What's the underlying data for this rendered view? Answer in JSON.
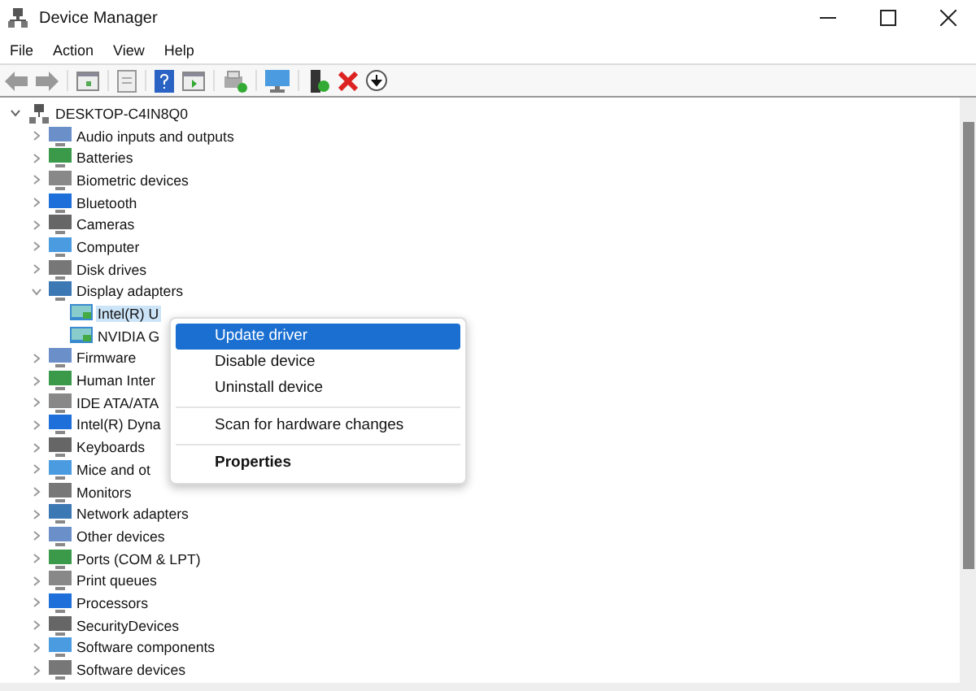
{
  "window": {
    "title": "Device Manager"
  },
  "menu_bar": [
    "File",
    "Action",
    "View",
    "Help"
  ],
  "tree": {
    "label": "DESKTOP-C4IN8Q0",
    "expanded": true,
    "selected": false,
    "children": [
      {
        "label": "Audio inputs and outputs",
        "expanded": false,
        "selected": false
      },
      {
        "label": "Batteries",
        "expanded": false,
        "selected": false
      },
      {
        "label": "Biometric devices",
        "expanded": false,
        "selected": false
      },
      {
        "label": "Bluetooth",
        "expanded": false,
        "selected": false
      },
      {
        "label": "Cameras",
        "expanded": false,
        "selected": false
      },
      {
        "label": "Computer",
        "expanded": false,
        "selected": false
      },
      {
        "label": "Disk drives",
        "expanded": false,
        "selected": false
      },
      {
        "label": "Display adapters",
        "expanded": true,
        "selected": false,
        "children": [
          {
            "label": "Intel(R) U",
            "selected": true
          },
          {
            "label": "NVIDIA G",
            "selected": false
          }
        ]
      },
      {
        "label": "Firmware",
        "expanded": false,
        "selected": false
      },
      {
        "label": "Human Inter",
        "expanded": false,
        "selected": false
      },
      {
        "label": "IDE ATA/ATA",
        "expanded": false,
        "selected": false
      },
      {
        "label": "Intel(R) Dyna",
        "expanded": false,
        "selected": false
      },
      {
        "label": "Keyboards",
        "expanded": false,
        "selected": false
      },
      {
        "label": "Mice and ot",
        "expanded": false,
        "selected": false
      },
      {
        "label": "Monitors",
        "expanded": false,
        "selected": false
      },
      {
        "label": "Network adapters",
        "expanded": false,
        "selected": false
      },
      {
        "label": "Other devices",
        "expanded": false,
        "selected": false
      },
      {
        "label": "Ports (COM & LPT)",
        "expanded": false,
        "selected": false
      },
      {
        "label": "Print queues",
        "expanded": false,
        "selected": false
      },
      {
        "label": "Processors",
        "expanded": false,
        "selected": false
      },
      {
        "label": "SecurityDevices",
        "expanded": false,
        "selected": false
      },
      {
        "label": "Software components",
        "expanded": false,
        "selected": false
      },
      {
        "label": "Software devices",
        "expanded": false,
        "selected": false
      }
    ]
  },
  "context_menu": [
    {
      "kind": "item",
      "label": "Update driver",
      "selected": true
    },
    {
      "kind": "item",
      "label": "Disable device",
      "selected": false
    },
    {
      "kind": "item",
      "label": "Uninstall device",
      "selected": false
    },
    {
      "kind": "separator"
    },
    {
      "kind": "item",
      "label": "Scan for hardware changes",
      "selected": false
    },
    {
      "kind": "separator"
    },
    {
      "kind": "default",
      "label": "Properties",
      "selected": false
    }
  ]
}
